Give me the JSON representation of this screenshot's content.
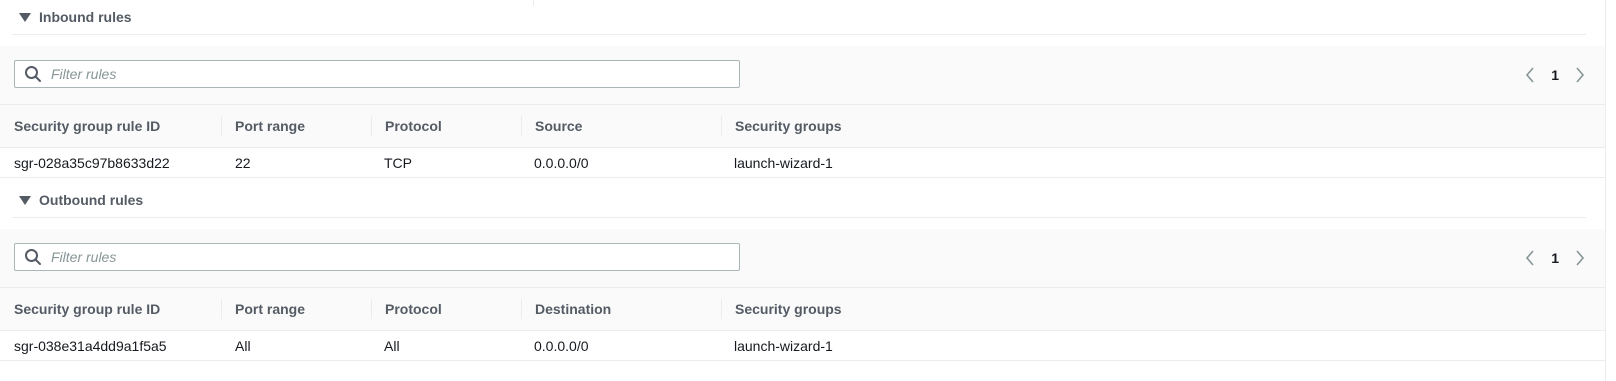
{
  "inbound": {
    "title": "Inbound rules",
    "filter_placeholder": "Filter rules",
    "page": "1",
    "columns": [
      "Security group rule ID",
      "Port range",
      "Protocol",
      "Source",
      "Security groups"
    ],
    "rows": [
      [
        "sgr-028a35c97b8633d22",
        "22",
        "TCP",
        "0.0.0.0/0",
        "launch-wizard-1"
      ]
    ]
  },
  "outbound": {
    "title": "Outbound rules",
    "filter_placeholder": "Filter rules",
    "page": "1",
    "columns": [
      "Security group rule ID",
      "Port range",
      "Protocol",
      "Destination",
      "Security groups"
    ],
    "rows": [
      [
        "sgr-038e31a4dd9a1f5a5",
        "All",
        "All",
        "0.0.0.0/0",
        "launch-wizard-1"
      ]
    ]
  },
  "icons": {
    "expand": "caret-down-icon",
    "search": "search-icon",
    "prev": "chevron-left-icon",
    "next": "chevron-right-icon"
  },
  "colors": {
    "header_text": "#545b64",
    "body_text": "#16191f",
    "border": "#eaeded",
    "stripe": "#fafafa",
    "input_border": "#aab7b8",
    "placeholder": "#879596"
  }
}
